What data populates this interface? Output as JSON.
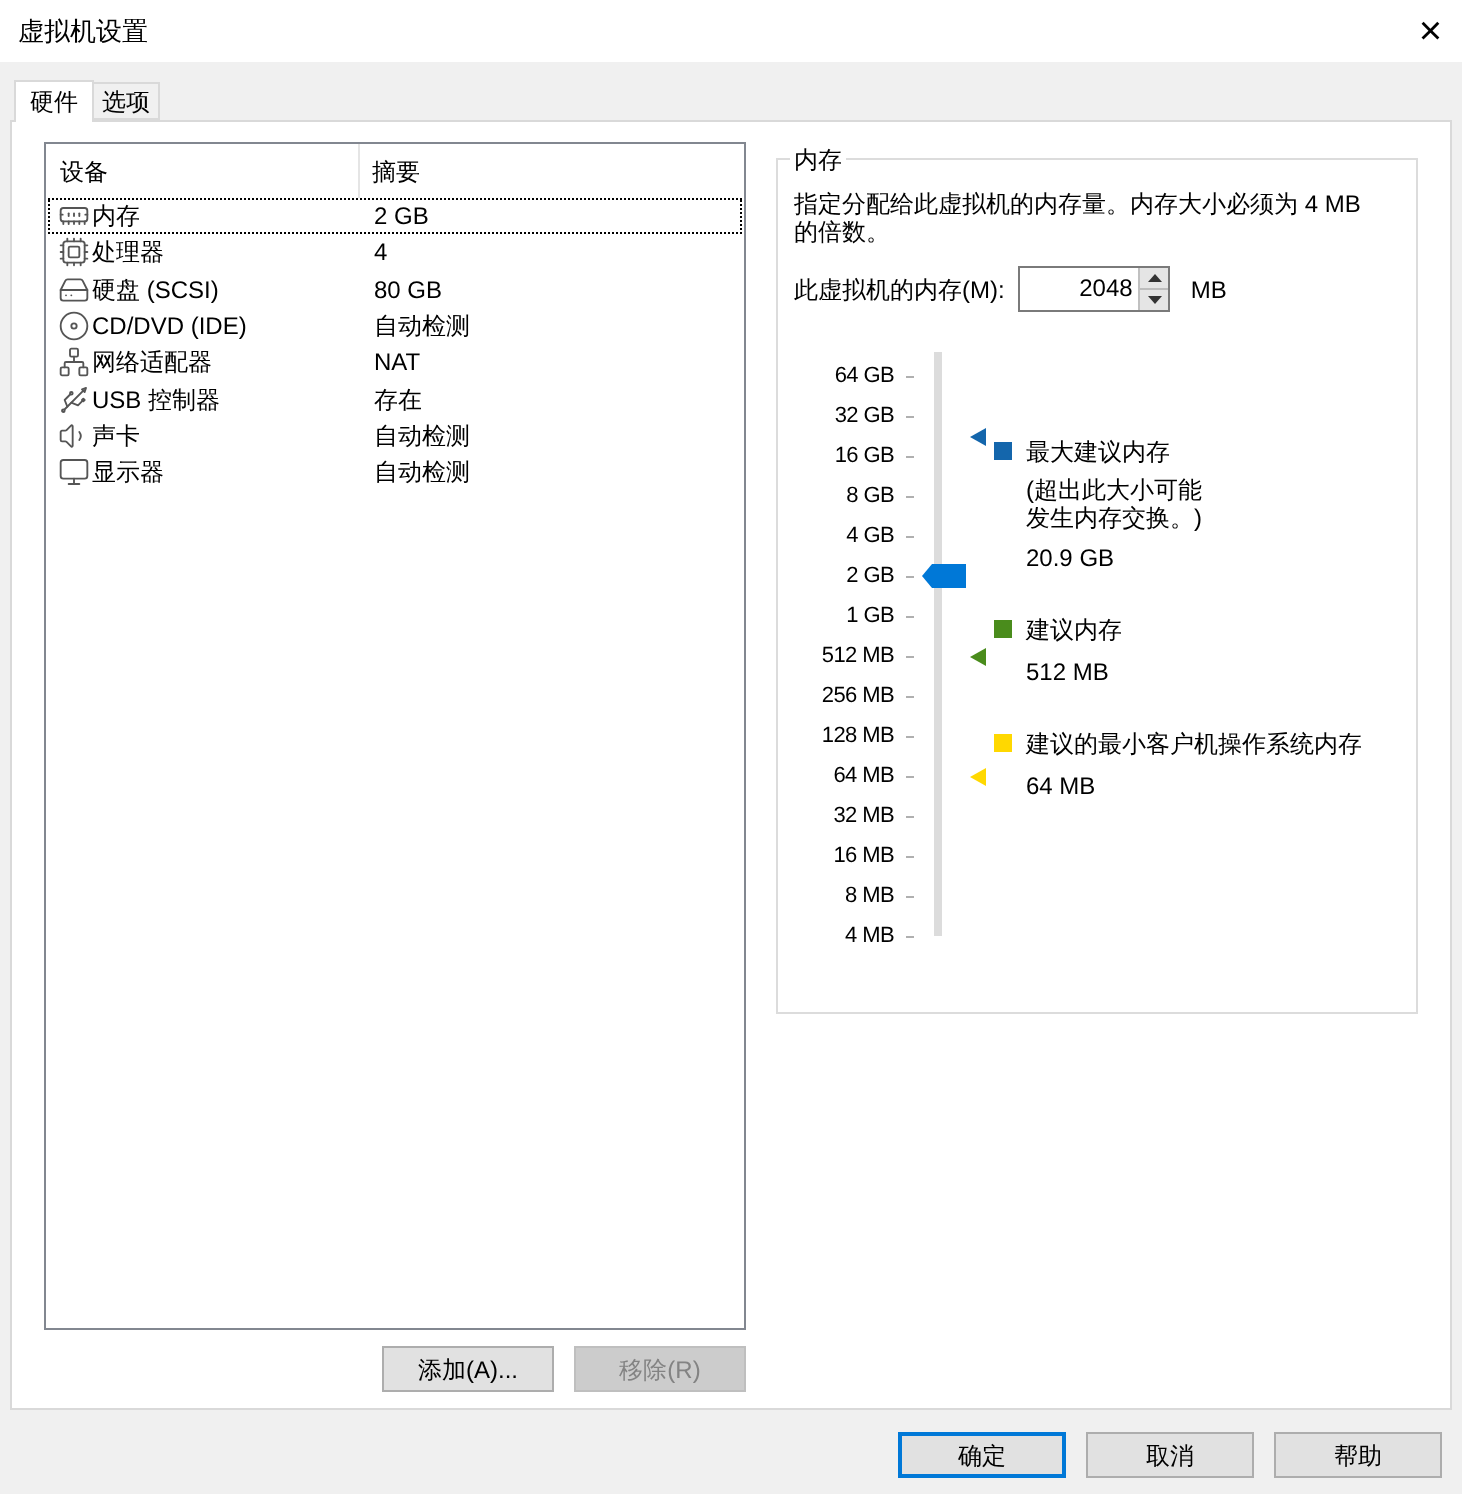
{
  "window": {
    "title": "虚拟机设置",
    "close": "×"
  },
  "tabs": [
    {
      "label": "硬件",
      "selected": true
    },
    {
      "label": "选项",
      "selected": false
    }
  ],
  "devices": {
    "columns": [
      "设备",
      "摘要"
    ],
    "rows": [
      {
        "kind": "memory",
        "name": "内存",
        "summary": "2 GB",
        "selected": true
      },
      {
        "kind": "cpu",
        "name": "处理器",
        "summary": "4",
        "selected": false
      },
      {
        "kind": "disk",
        "name": "硬盘 (SCSI)",
        "summary": "80 GB",
        "selected": false
      },
      {
        "kind": "cd",
        "name": "CD/DVD (IDE)",
        "summary": "自动检测",
        "selected": false
      },
      {
        "kind": "network",
        "name": "网络适配器",
        "summary": "NAT",
        "selected": false
      },
      {
        "kind": "usb",
        "name": "USB 控制器",
        "summary": "存在",
        "selected": false
      },
      {
        "kind": "sound",
        "name": "声卡",
        "summary": "自动检测",
        "selected": false
      },
      {
        "kind": "display",
        "name": "显示器",
        "summary": "自动检测",
        "selected": false
      }
    ]
  },
  "list_buttons": [
    {
      "label": "添加(A)...",
      "disabled": false
    },
    {
      "label": "移除(R)",
      "disabled": true
    }
  ],
  "memory": {
    "title": "内存",
    "description": "指定分配给此虚拟机的内存量。内存大小必须为 4 MB 的倍数。",
    "field_label": "此虚拟机的内存(M):",
    "value": "2048",
    "unit": "MB",
    "scale": [
      "64 GB",
      "32 GB",
      "16 GB",
      "8 GB",
      "4 GB",
      "2 GB",
      "1 GB",
      "512 MB",
      "256 MB",
      "128 MB",
      "64 MB",
      "32 MB",
      "16 MB",
      "8 MB",
      "4 MB"
    ],
    "slider": {
      "level": 0.643
    },
    "markers": [
      {
        "title": "最大建议内存",
        "note_lines": [
          "(超出此大小可能",
          "发生内存交换。)"
        ],
        "value": "20.9 GB",
        "color": "#1466ac"
      },
      {
        "title": "建议内存",
        "value": "512 MB",
        "color": "#4a8c1c"
      },
      {
        "title": "建议的最小客户机操作系统内存",
        "value": "64 MB",
        "color": "#ffd800"
      }
    ]
  },
  "buttons": [
    {
      "label": "确定",
      "default": true
    },
    {
      "label": "取消",
      "default": false
    },
    {
      "label": "帮助",
      "default": false
    }
  ]
}
